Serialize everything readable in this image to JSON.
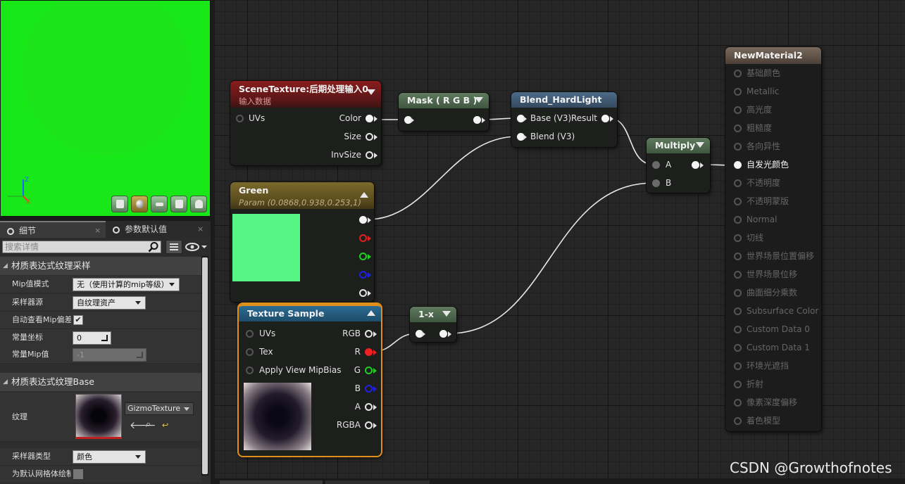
{
  "details_panel": {
    "tabs": [
      {
        "label": "细节"
      },
      {
        "label": "参数默认值"
      }
    ],
    "search": {
      "placeholder": "搜索详情"
    },
    "categories": [
      {
        "label": "材质表达式纹理采样"
      },
      {
        "label": "材质表达式纹理Base"
      }
    ],
    "properties": {
      "mip_value_mode": {
        "label": "Mip值模式",
        "value": "无（使用计算的mip等级）"
      },
      "sampler_source": {
        "label": "采样器源",
        "value": "自纹理资产"
      },
      "auto_view_mip_bias": {
        "label": "自动查看Mip偏差",
        "checked": true
      },
      "const_coordinate": {
        "label": "常量坐标",
        "value": "0"
      },
      "const_mip_value": {
        "label": "常量Mip值",
        "value": "-1"
      },
      "texture": {
        "label": "纹理",
        "value": "GizmoTexture"
      },
      "sampler_type": {
        "label": "采样器类型",
        "value": "颜色"
      },
      "default_mesh_painting": {
        "label": "为默认网格体绘制",
        "checked": false
      }
    }
  },
  "viewport": {
    "background_color": "#18e818",
    "axes": {
      "z": "Z",
      "x": "X"
    },
    "preview_buttons": [
      "cylinder-icon",
      "sphere-icon",
      "plane-icon",
      "cube-icon",
      "teapot-icon"
    ]
  },
  "graph": {
    "nodes": {
      "scene_texture": {
        "title": "SceneTexture:后期处理输入0",
        "subtitle": "输入数据",
        "inputs": [
          "UVs"
        ],
        "outputs": [
          "Color",
          "Size",
          "InvSize"
        ]
      },
      "mask": {
        "title": "Mask ( R G B )"
      },
      "blend": {
        "title": "Blend_HardLight",
        "inputs": [
          "Base (V3)",
          "Blend (V3)"
        ],
        "output": "Result"
      },
      "multiply": {
        "title": "Multiply",
        "inputs": [
          "A",
          "B"
        ]
      },
      "green": {
        "title": "Green",
        "subtitle": "Param (0.0868,0.938,0.253,1)",
        "swatch_color": "#56f584"
      },
      "texture_sample": {
        "title": "Texture Sample",
        "inputs": [
          "UVs",
          "Tex",
          "Apply View MipBias"
        ],
        "outputs": [
          "RGB",
          "R",
          "G",
          "B",
          "A",
          "RGBA"
        ]
      },
      "one_minus": {
        "title": "1-x"
      },
      "result": {
        "title": "NewMaterial2",
        "pins": [
          {
            "label": "基础颜色",
            "active": false
          },
          {
            "label": "Metallic",
            "active": false
          },
          {
            "label": "高光度",
            "active": false
          },
          {
            "label": "粗糙度",
            "active": false
          },
          {
            "label": "各向异性",
            "active": false
          },
          {
            "label": "自发光颜色",
            "active": true
          },
          {
            "label": "不透明度",
            "active": false
          },
          {
            "label": "不透明蒙版",
            "active": false
          },
          {
            "label": "Normal",
            "active": false
          },
          {
            "label": "切线",
            "active": false
          },
          {
            "label": "世界场景位置偏移",
            "active": false
          },
          {
            "label": "世界场景位移",
            "active": false
          },
          {
            "label": "曲面细分乘数",
            "active": false
          },
          {
            "label": "Subsurface Color",
            "active": false
          },
          {
            "label": "Custom Data 0",
            "active": false
          },
          {
            "label": "Custom Data 1",
            "active": false
          },
          {
            "label": "环境光遮挡",
            "active": false
          },
          {
            "label": "折射",
            "active": false
          },
          {
            "label": "像素深度偏移",
            "active": false
          },
          {
            "label": "着色模型",
            "active": false
          }
        ]
      }
    }
  },
  "watermark": "CSDN @Growthofnotes"
}
